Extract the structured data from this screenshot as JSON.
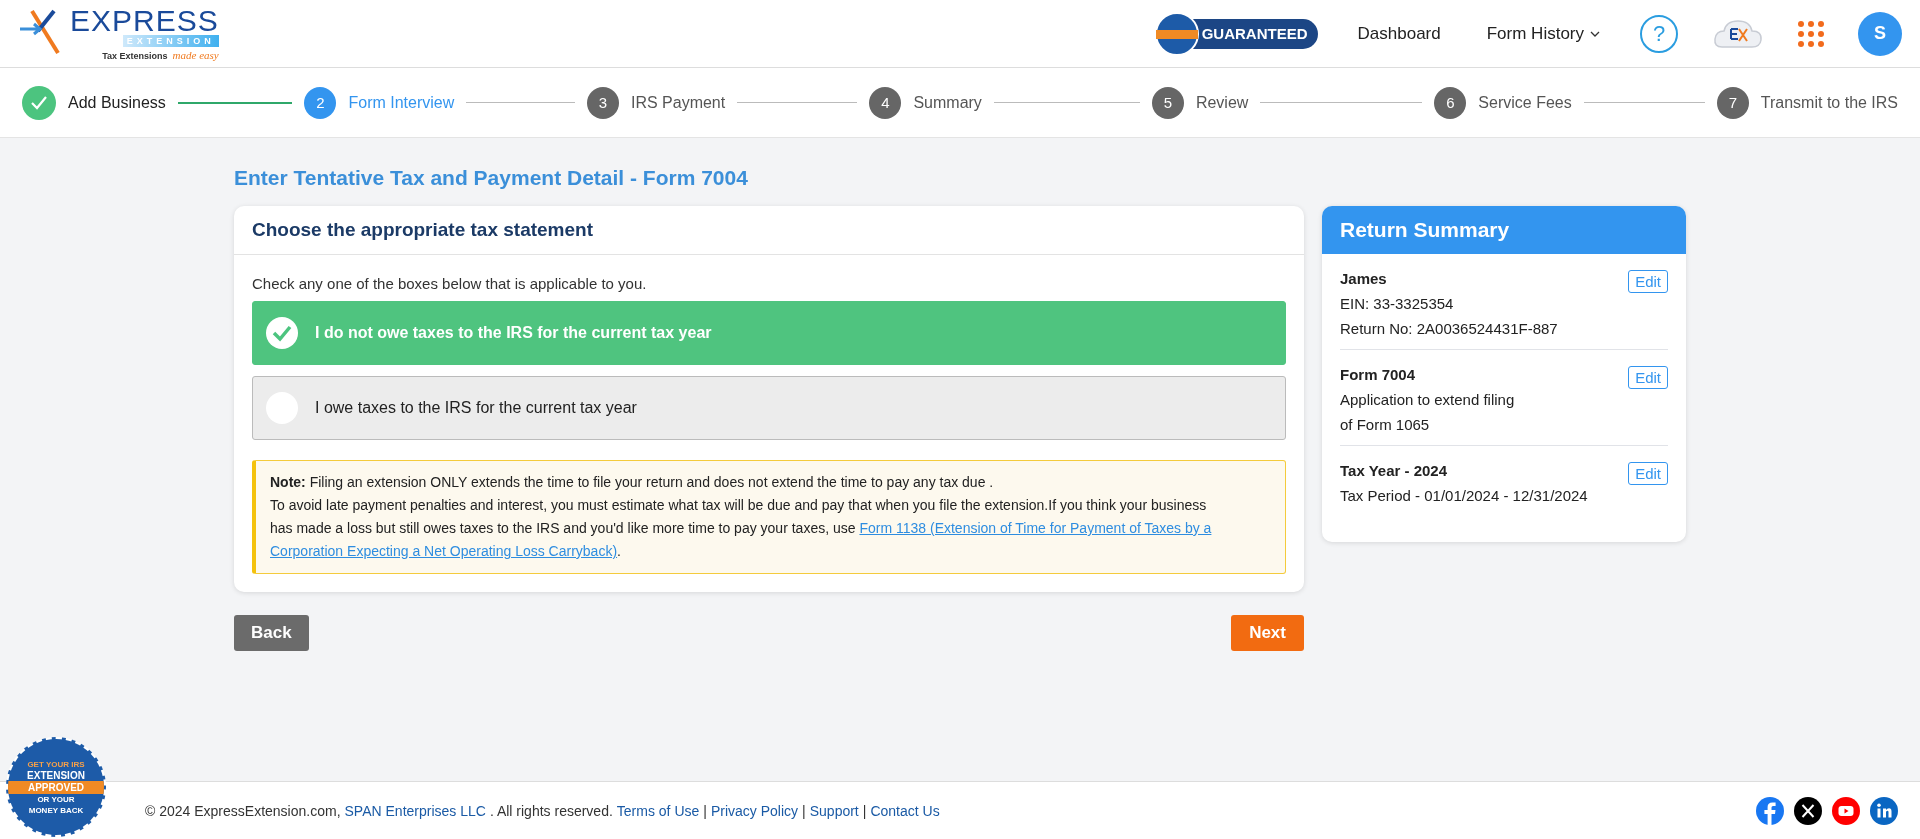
{
  "header": {
    "logo": {
      "word": "EXPRESS",
      "band": "EXTENSION",
      "tagline": "Tax Extensions",
      "slogan": "made easy"
    },
    "badge": "GUARANTEED",
    "nav": [
      {
        "label": "Dashboard",
        "dropdown": false
      },
      {
        "label": "Form History",
        "dropdown": true
      }
    ],
    "help": "?",
    "avatar": "S"
  },
  "steps": [
    {
      "label": "Add Business",
      "completed": true,
      "selected": false
    },
    {
      "number": "2",
      "label": "Form Interview",
      "completed": false,
      "selected": true
    },
    {
      "number": "3",
      "label": "IRS Payment",
      "completed": false,
      "selected": false
    },
    {
      "number": "4",
      "label": "Summary",
      "completed": false,
      "selected": false
    },
    {
      "number": "5",
      "label": "Review",
      "completed": false,
      "selected": false
    },
    {
      "number": "6",
      "label": "Service Fees",
      "completed": false,
      "selected": false
    },
    {
      "number": "7",
      "label": "Transmit to the IRS",
      "completed": false,
      "selected": false
    }
  ],
  "page_title": "Enter Tentative Tax and Payment Detail - Form 7004",
  "statement_card": {
    "title": "Choose the appropriate tax statement",
    "instruction": "Check any one of the boxes below that is applicable to you.",
    "options": [
      {
        "label": "I do not owe taxes to the IRS for the current tax year",
        "selected": true
      },
      {
        "label": "I owe taxes to the IRS for the current tax year",
        "selected": false
      }
    ],
    "note": {
      "text": "**Note:** Filing an extension ONLY extends the time to file your return and does not extend the time to pay any tax due .",
      "body": [
        "To avoid late payment penalties and interest, you must estimate what tax will be due and pay that when you file the extension.If you think your business",
        "has made a loss but still owes taxes to the IRS and you'd like more time to pay your taxes, use"
      ],
      "link": [
        "Form 1138 (Extension of Time for Payment of Taxes by a",
        "Corporation Expecting a Net Operating Loss Carryback)"
      ],
      "tail": "."
    }
  },
  "buttons": {
    "back": "Back",
    "next": "Next"
  },
  "summary": {
    "title": "Return Summary",
    "sections": [
      {
        "heading": "James",
        "lines": [
          "EIN: 33-3325354",
          "Return No: 2A0036524431F-887"
        ],
        "edit": "Edit"
      },
      {
        "heading": "Form 7004",
        "lines": [
          "Application to extend filing",
          "of Form 1065"
        ],
        "edit": "Edit"
      },
      {
        "heading": "Tax Year - 2024",
        "lines": [
          "Tax Period - 01/01/2024 - 12/31/2024"
        ],
        "edit": "Edit"
      }
    ]
  },
  "footer": {
    "seal": [
      "GET YOUR IRS",
      "EXTENSION",
      "APPROVED",
      "OR YOUR",
      "MONEY BACK"
    ],
    "items": [
      {
        "kind": "text",
        "text": "© 2024 ExpressExtension.com,"
      },
      {
        "kind": "link",
        "text": "SPAN Enterprises LLC"
      },
      {
        "kind": "text",
        "text": ". All rights reserved."
      },
      {
        "kind": "link",
        "text": "Terms of Use"
      },
      {
        "kind": "text",
        "text": "|"
      },
      {
        "kind": "link",
        "text": "Privacy Policy"
      },
      {
        "kind": "text",
        "text": "|"
      },
      {
        "kind": "link",
        "text": "Support"
      },
      {
        "kind": "text",
        "text": "|"
      },
      {
        "kind": "link",
        "text": "Contact Us"
      }
    ]
  }
}
